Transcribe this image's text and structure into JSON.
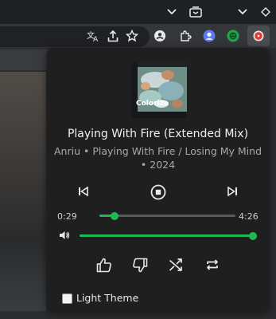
{
  "player": {
    "album_art_text": "Colorize",
    "title": "Playing With Fire (Extended Mix)",
    "subtitle": "Anriu • Playing With Fire / Losing My Mind • 2024",
    "time_elapsed": "0:29",
    "time_total": "4:26",
    "progress_fraction": 0.109,
    "volume_fraction": 1.0,
    "light_theme_label": "Light Theme",
    "light_theme_checked": false
  },
  "colors": {
    "accent": "#1db954",
    "popup_bg": "#1f1f1f"
  },
  "icons": {
    "top": [
      "chevron-down-icon",
      "tab-search-icon",
      "chevron-down-icon",
      "diamond-icon"
    ],
    "toolbar": [
      "translate-icon",
      "share-icon",
      "bookmark-star-icon",
      "account-icon",
      "extensions-icon",
      "profile-icon",
      "extension-green-icon",
      "extension-red-icon"
    ]
  }
}
